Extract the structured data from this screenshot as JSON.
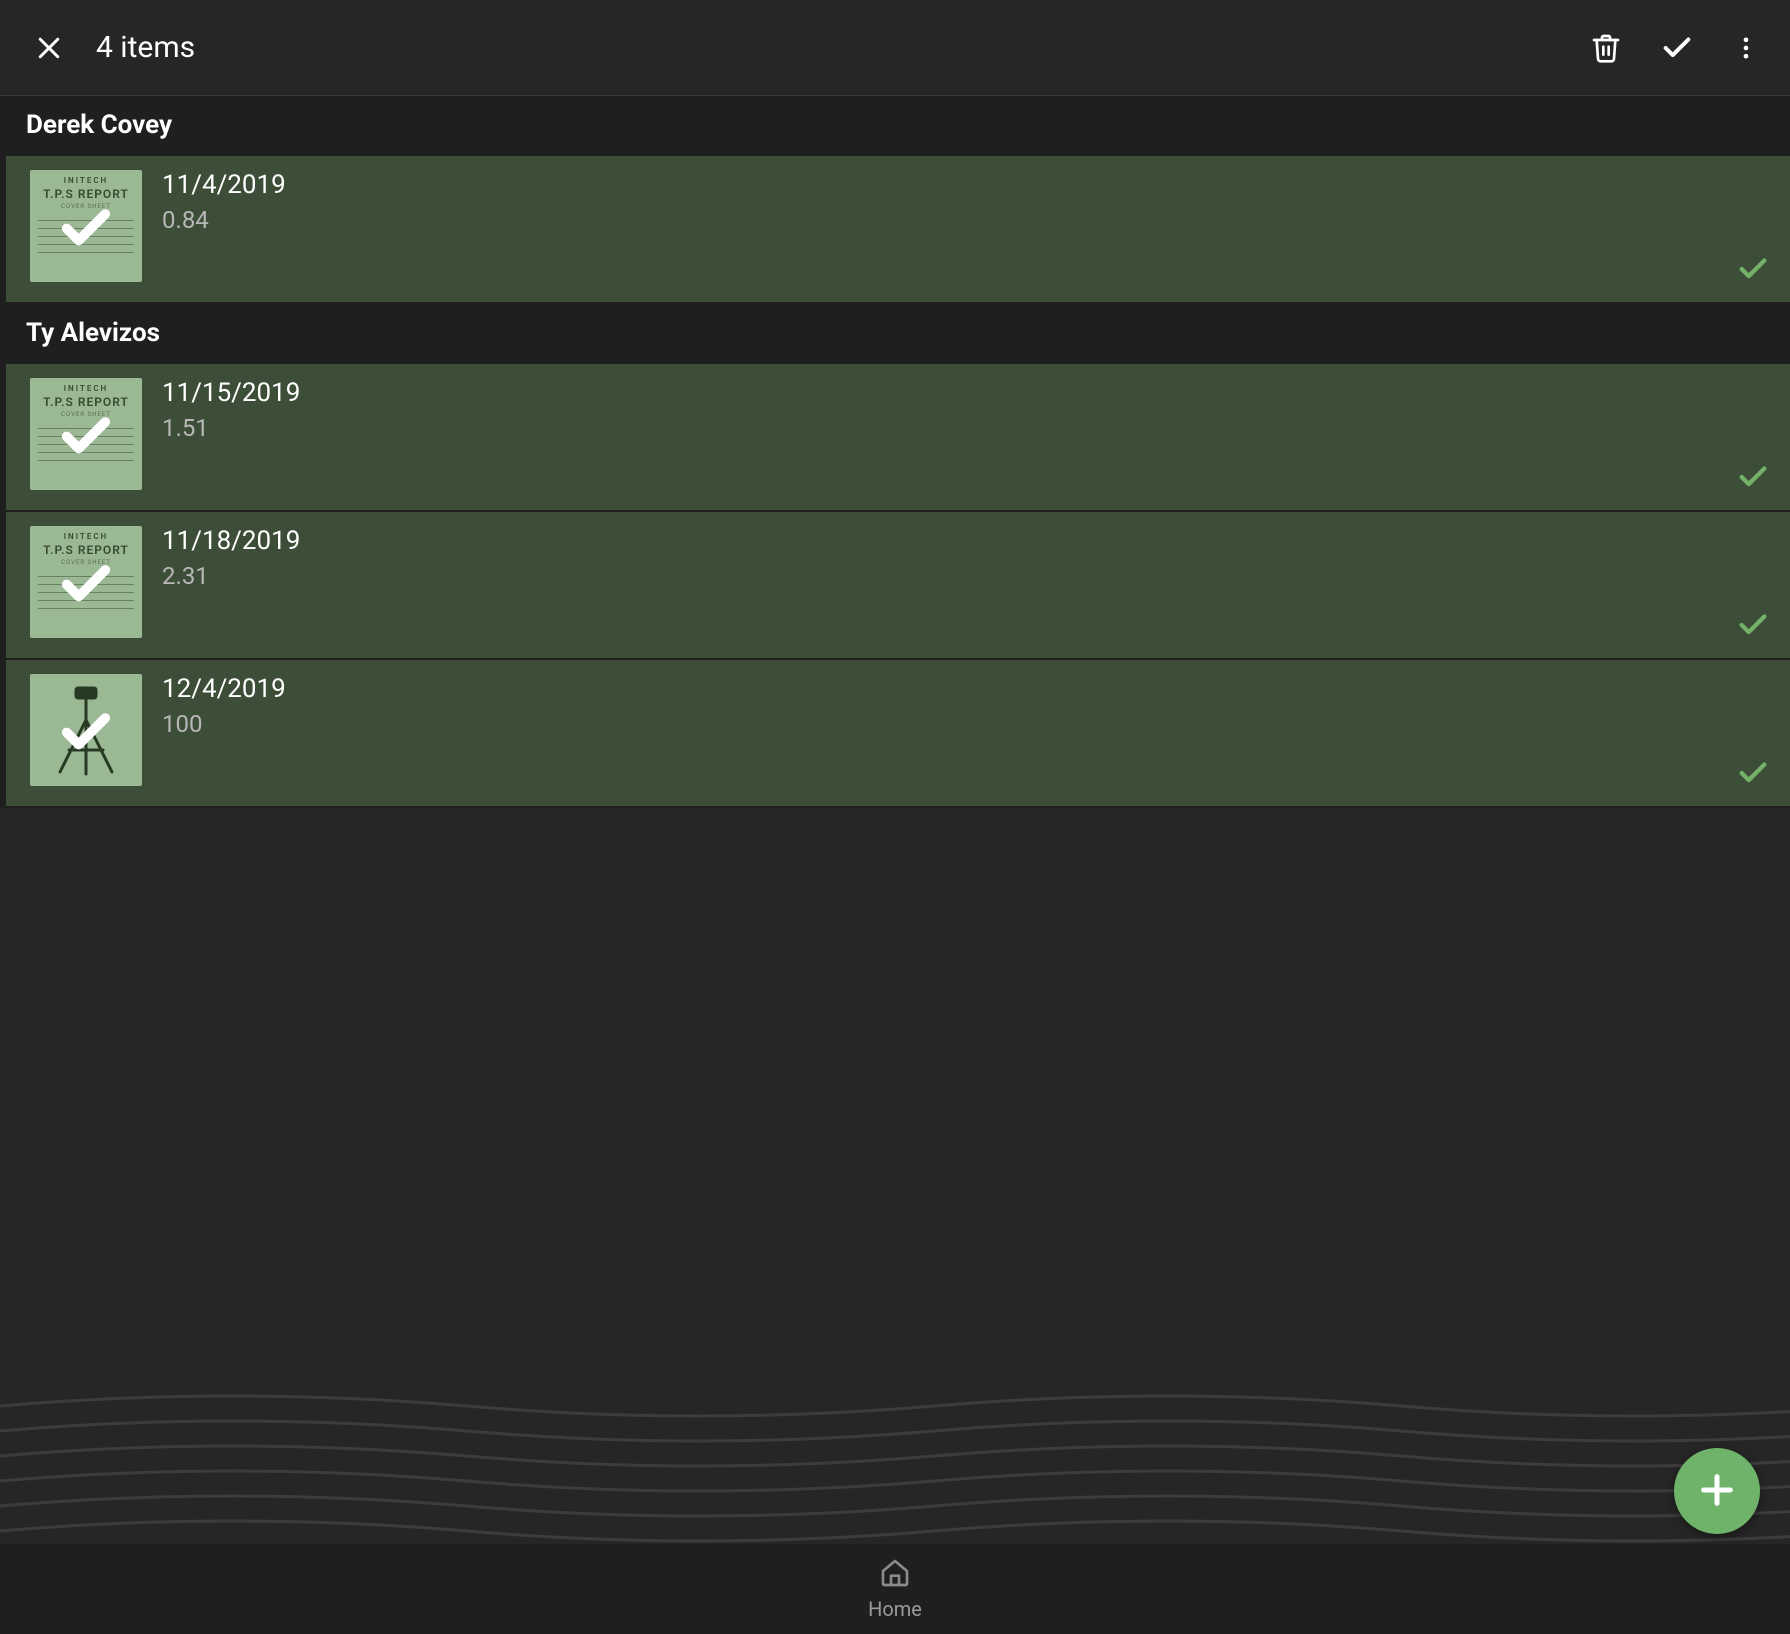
{
  "header": {
    "count_label": "4 items"
  },
  "nav": {
    "home_label": "Home"
  },
  "thumb": {
    "brand": "INITECH",
    "docname": "T.P.S REPORT",
    "subtitle": "COVER SHEET"
  },
  "colors": {
    "selected_row_bg": "#3c4d38",
    "accent": "#6fb36a",
    "tick": "#74b169"
  },
  "groups": [
    {
      "name": "Derek Covey",
      "rows": [
        {
          "date": "11/4/2019",
          "value": "0.84",
          "thumb_type": "tps",
          "selected": true,
          "approved": true
        }
      ]
    },
    {
      "name": "Ty Alevizos",
      "rows": [
        {
          "date": "11/15/2019",
          "value": "1.51",
          "thumb_type": "tps",
          "selected": true,
          "approved": true
        },
        {
          "date": "11/18/2019",
          "value": "2.31",
          "thumb_type": "tps",
          "selected": true,
          "approved": true
        },
        {
          "date": "12/4/2019",
          "value": "100",
          "thumb_type": "tripod",
          "selected": true,
          "approved": true
        }
      ]
    }
  ]
}
